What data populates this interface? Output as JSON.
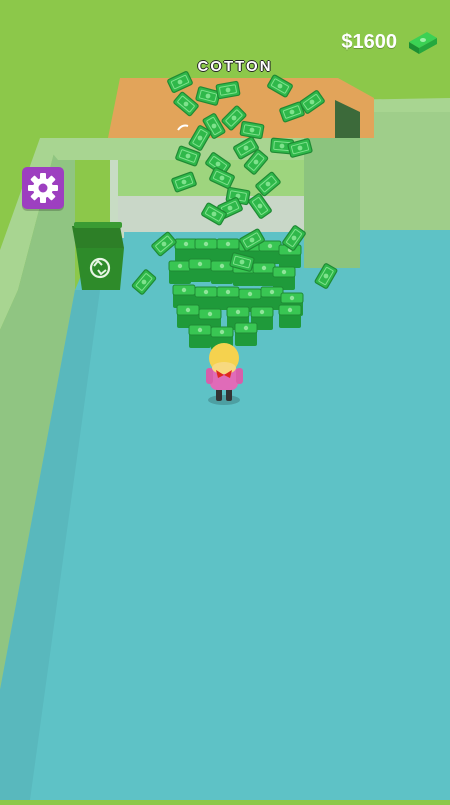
{
  "hud": {
    "money": "$1600",
    "money_icon": "cash-stack-icon",
    "settings_icon": "gear-icon"
  },
  "station": {
    "sign_text": "COTTON"
  },
  "colors": {
    "grass": "#8cc84a",
    "floor": "#5ec2c6",
    "wall_top": "#9fce8a",
    "counter": "#e2a45a",
    "cash": "#35c44a",
    "settings_bg": "#9d3fc0",
    "bin": "#2e8b2a"
  }
}
